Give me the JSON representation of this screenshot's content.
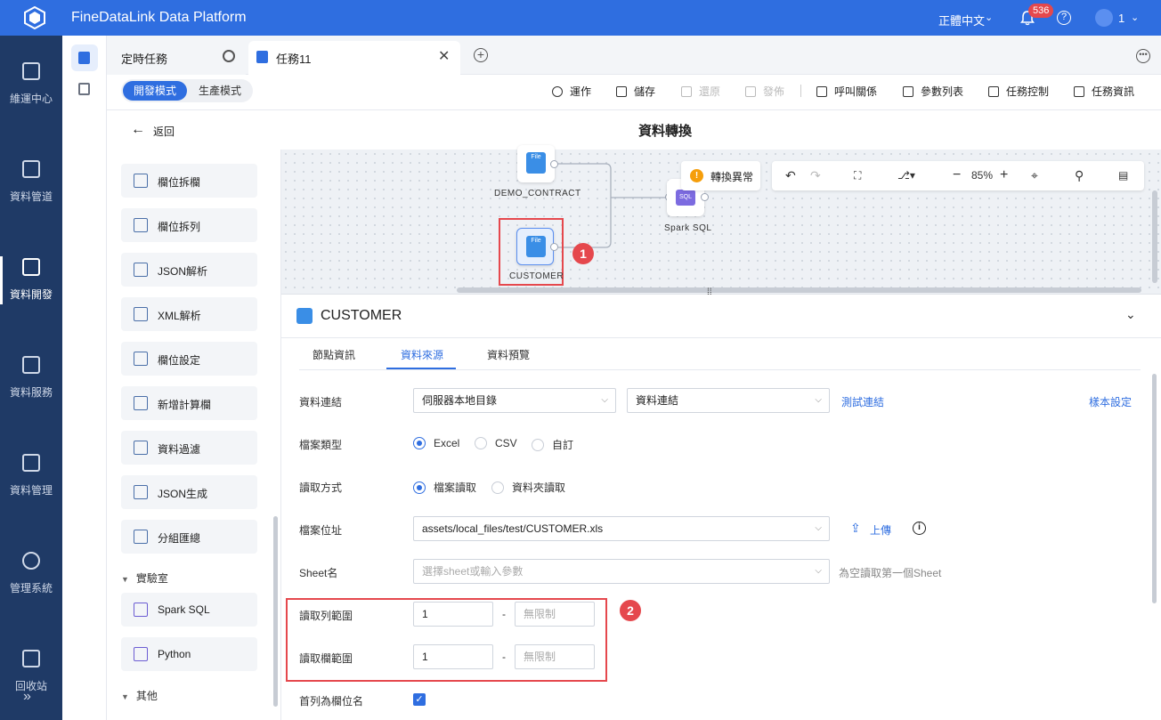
{
  "app": {
    "title": "FineDataLink Data Platform",
    "language": "正體中文",
    "notification_count": "536",
    "user": "1"
  },
  "left_nav": [
    {
      "label": "維運中心",
      "icon": "clipboard-check-icon"
    },
    {
      "label": "資料管道",
      "icon": "pipeline-icon"
    },
    {
      "label": "資料開發",
      "icon": "data-dev-icon",
      "active": true
    },
    {
      "label": "資料服務",
      "icon": "data-service-icon"
    },
    {
      "label": "資料管理",
      "icon": "data-manage-icon"
    },
    {
      "label": "管理系統",
      "icon": "gear-icon"
    },
    {
      "label": "回收站",
      "icon": "recycle-icon"
    }
  ],
  "tabs": [
    {
      "label": "定時任務"
    },
    {
      "label": "任務11"
    }
  ],
  "modes": {
    "dev": "開發模式",
    "prod": "生產模式"
  },
  "toolbar": {
    "run": "運作",
    "save": "儲存",
    "restore": "還原",
    "publish": "發佈",
    "call_relation": "呼叫關係",
    "param_list": "參數列表",
    "task_control": "任務控制",
    "task_info": "任務資訊"
  },
  "header": {
    "back": "返回",
    "title": "資料轉換"
  },
  "operators": [
    {
      "label": "欄位拆欄"
    },
    {
      "label": "欄位拆列"
    },
    {
      "label": "JSON解析"
    },
    {
      "label": "XML解析"
    },
    {
      "label": "欄位設定"
    },
    {
      "label": "新增計算欄"
    },
    {
      "label": "資料過濾"
    },
    {
      "label": "JSON生成"
    },
    {
      "label": "分組匯總"
    }
  ],
  "lab_group": {
    "label": "實驗室",
    "items": [
      {
        "label": "Spark SQL"
      },
      {
        "label": "Python"
      }
    ]
  },
  "other_group": {
    "label": "其他"
  },
  "canvas": {
    "nodes": [
      {
        "label": "DEMO_CONTRACT",
        "icon_text": "File"
      },
      {
        "label": "CUSTOMER",
        "icon_text": "File"
      },
      {
        "label": "Spark SQL",
        "icon_text": "SQL"
      }
    ],
    "warning": "轉換異常",
    "zoom": "85%",
    "markers": [
      "1",
      "2"
    ]
  },
  "detail": {
    "title": "CUSTOMER",
    "tabs": [
      "節點資訊",
      "資料來源",
      "資料預覽"
    ],
    "active_tab": "資料來源",
    "fields": {
      "connection": {
        "label": "資料連結",
        "value1": "伺服器本地目錄",
        "value2": "資料連結",
        "test_link": "測試連結",
        "sample_link": "樣本設定"
      },
      "file_type": {
        "label": "檔案類型",
        "options": [
          "Excel",
          "CSV",
          "自訂"
        ],
        "selected": "Excel"
      },
      "read_mode": {
        "label": "讀取方式",
        "options": [
          "檔案讀取",
          "資料夾讀取"
        ],
        "selected": "檔案讀取"
      },
      "file_path": {
        "label": "檔案位址",
        "value": "assets/local_files/test/CUSTOMER.xls",
        "upload": "上傳"
      },
      "sheet": {
        "label": "Sheet名",
        "placeholder": "選擇sheet或輸入參數",
        "hint": "為空讀取第一個Sheet"
      },
      "row_range": {
        "label": "讀取列範圍",
        "from": "1",
        "to_placeholder": "無限制"
      },
      "col_range": {
        "label": "讀取欄範圍",
        "from": "1",
        "to_placeholder": "無限制"
      },
      "first_row_header": {
        "label": "首列為欄位名",
        "checked": true
      }
    }
  }
}
